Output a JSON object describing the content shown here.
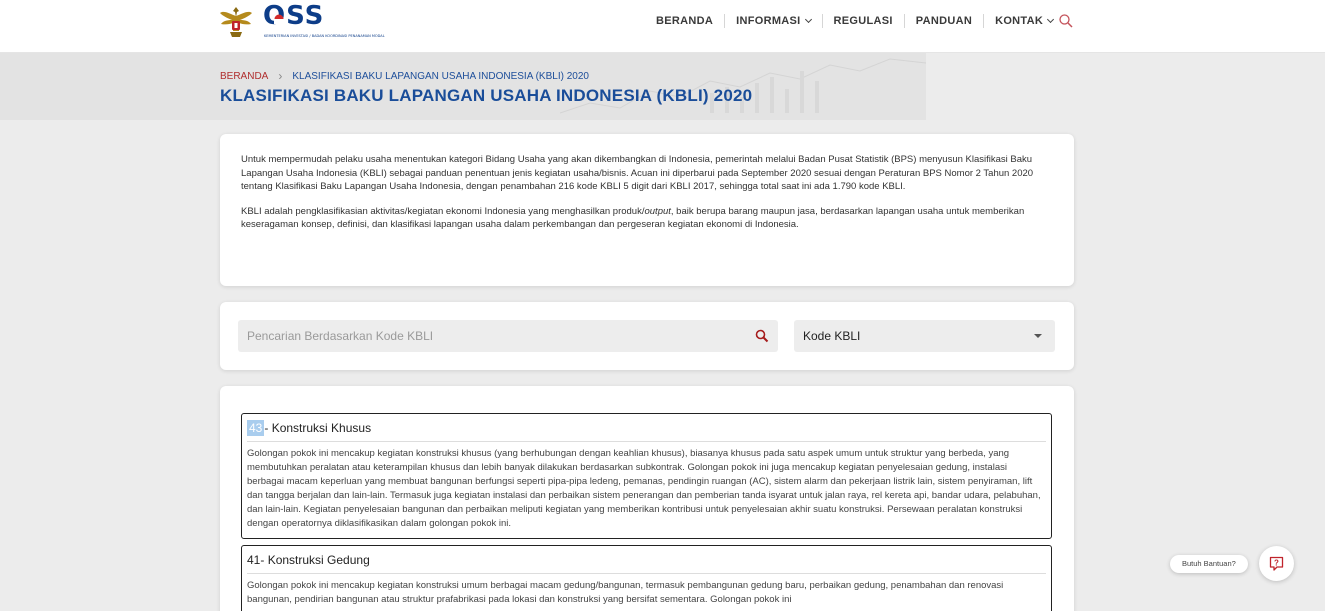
{
  "header": {
    "logo_text": "OSS",
    "logo_sub": "KEMENTERIAN INVESTASI / BADAN KOORDINASI PENANAMAN MODAL",
    "nav": [
      {
        "label": "BERANDA"
      },
      {
        "label": "INFORMASI"
      },
      {
        "label": "REGULASI"
      },
      {
        "label": "PANDUAN"
      },
      {
        "label": "KONTAK"
      }
    ]
  },
  "breadcrumb": {
    "home": "BERANDA",
    "separator": "›",
    "current": "KLASIFIKASI BAKU LAPANGAN USAHA INDONESIA (KBLI) 2020"
  },
  "page_title": "KLASIFIKASI BAKU LAPANGAN USAHA INDONESIA (KBLI) 2020",
  "intro": {
    "p1": "Untuk mempermudah pelaku usaha menentukan kategori Bidang Usaha yang akan dikembangkan di Indonesia, pemerintah melalui Badan Pusat Statistik (BPS) menyusun Klasifikasi Baku Lapangan Usaha Indonesia (KBLI) sebagai panduan penentuan jenis kegiatan usaha/bisnis. Acuan ini diperbarui pada September 2020 sesuai dengan Peraturan BPS Nomor 2 Tahun 2020 tentang Klasifikasi Baku Lapangan Usaha Indonesia, dengan penambahan 216 kode KBLI 5 digit dari KBLI 2017, sehingga total saat ini ada 1.790 kode KBLI.",
    "p2_a": "KBLI adalah pengklasifikasian aktivitas/kegiatan ekonomi Indonesia yang menghasilkan produk/",
    "p2_em": "output",
    "p2_b": ", baik berupa barang maupun jasa, berdasarkan lapangan usaha untuk memberikan keseragaman konsep, definisi, dan klasifikasi lapangan usaha dalam perkembangan dan pergeseran kegiatan ekonomi di Indonesia."
  },
  "search": {
    "placeholder": "Pencarian Berdasarkan Kode KBLI",
    "value": "",
    "select_value": "Kode KBLI"
  },
  "results": [
    {
      "code": "43",
      "title": " - Konstruksi Khusus",
      "description": "Golongan pokok ini mencakup kegiatan konstruksi khusus (yang berhubungan dengan keahlian khusus), biasanya khusus pada satu aspek umum untuk struktur yang berbeda, yang membutuhkan peralatan atau keterampilan khusus dan lebih banyak dilakukan berdasarkan subkontrak. Golongan pokok ini juga mencakup kegiatan penyelesaian gedung, instalasi berbagai macam keperluan yang membuat bangunan berfungsi seperti pipa-pipa ledeng, pemanas, pendingin ruangan (AC), sistem alarm dan pekerjaan listrik lain, sistem penyiraman, lift dan tangga berjalan dan lain-lain. Termasuk juga kegiatan instalasi dan perbaikan sistem penerangan dan pemberian tanda isyarat untuk jalan raya, rel kereta api, bandar udara, pelabuhan, dan lain-lain. Kegiatan penyelesaian bangunan dan perbaikan meliputi kegiatan yang memberikan kontribusi untuk penyelesaian akhir suatu konstruksi. Persewaan peralatan konstruksi dengan operatornya diklasifikasikan dalam golongan pokok ini."
    },
    {
      "code": "41",
      "title": " - Konstruksi Gedung",
      "description": "Golongan pokok ini mencakup kegiatan konstruksi umum berbagai macam gedung/bangunan, termasuk pembangunan gedung baru, perbaikan gedung, penambahan dan renovasi bangunan, pendirian bangunan atau struktur prafabrikasi pada lokasi dan konstruksi yang bersifat sementara. Golongan pokok ini"
    }
  ],
  "help": {
    "label": "Butuh Bantuan?"
  },
  "colors": {
    "primary": "#1a4d99",
    "breadcrumb_home": "#b02d2d",
    "highlight": "#a9cdee",
    "search_icon": "#a61c1c",
    "help_icon": "#c0242c"
  }
}
